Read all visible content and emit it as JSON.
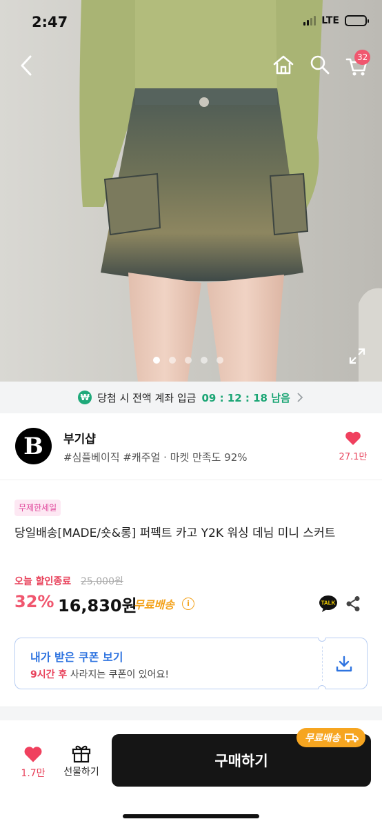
{
  "status_bar": {
    "time": "2:47",
    "network": "LTE"
  },
  "header": {
    "cart_count": "32"
  },
  "gallery": {
    "slide_count": 5,
    "active_slide": 1
  },
  "deadline": {
    "text": "당첨 시 전액 계좌 입금",
    "countdown": "09 : 12 : 18 남음"
  },
  "seller": {
    "logo_letter": "B",
    "name": "부기샵",
    "meta": "#심플베이직 #캐주얼 · 마켓 만족도 92%",
    "likes": "27.1만"
  },
  "product": {
    "tag": "무제한세일",
    "title": "당일배송[MADE/숏&롱] 퍼펙트 카고 Y2K 워싱 데님 미니 스커트",
    "sale_end": "오늘 할인종료",
    "original_price": "25,000원",
    "discount": "32%",
    "price": "16,830원",
    "shipping": "무료배송",
    "info_glyph": "i"
  },
  "coupon": {
    "title": "내가 받은 쿠폰 보기",
    "sub_highlight": "9시간 후",
    "sub_rest": " 사라지는 쿠폰이 있어요!"
  },
  "bottom_bar": {
    "likes": "1.7만",
    "gift_label": "선물하기",
    "buy_label": "구매하기",
    "shipping_badge": "무료배송"
  },
  "colors": {
    "accent_pink": "#f0576f",
    "timer_green": "#1aa574",
    "coupon_blue": "#2f74e0",
    "shipping_orange": "#f3a21b",
    "buy_button": "#151515"
  }
}
